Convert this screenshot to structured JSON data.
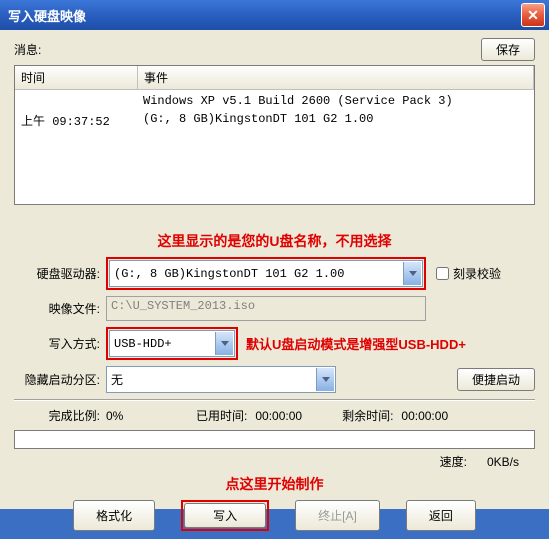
{
  "title": "写入硬盘映像",
  "msg_label": "消息:",
  "save_btn": "保存",
  "grid": {
    "col_time": "时间",
    "col_event": "事件",
    "rows": [
      {
        "time": "",
        "event": "Windows XP v5.1 Build 2600 (Service Pack 3)"
      },
      {
        "time": "上午 09:37:52",
        "event": "(G:, 8 GB)KingstonDT 101 G2      1.00"
      }
    ]
  },
  "anno1": "这里显示的是您的U盘名称，不用选择",
  "drive_label": "硬盘驱动器:",
  "drive_value": "(G:, 8 GB)KingstonDT 101 G2      1.00",
  "verify_label": "刻录校验",
  "image_label": "映像文件:",
  "image_value": "C:\\U_SYSTEM_2013.iso",
  "mode_label": "写入方式:",
  "mode_value": "USB-HDD+",
  "anno2": "默认U盘启动模式是增强型USB-HDD+",
  "hidden_label": "隐藏启动分区:",
  "hidden_value": "无",
  "convenient_btn": "便捷启动",
  "progress_label": "完成比例:",
  "progress_value": "0%",
  "elapsed_label": "已用时间:",
  "elapsed_value": "00:00:00",
  "remain_label": "剩余时间:",
  "remain_value": "00:00:00",
  "speed_label": "速度:",
  "speed_value": "0KB/s",
  "anno3": "点这里开始制作",
  "btn_format": "格式化",
  "btn_write": "写入",
  "btn_stop": "终止[A]",
  "btn_back": "返回"
}
